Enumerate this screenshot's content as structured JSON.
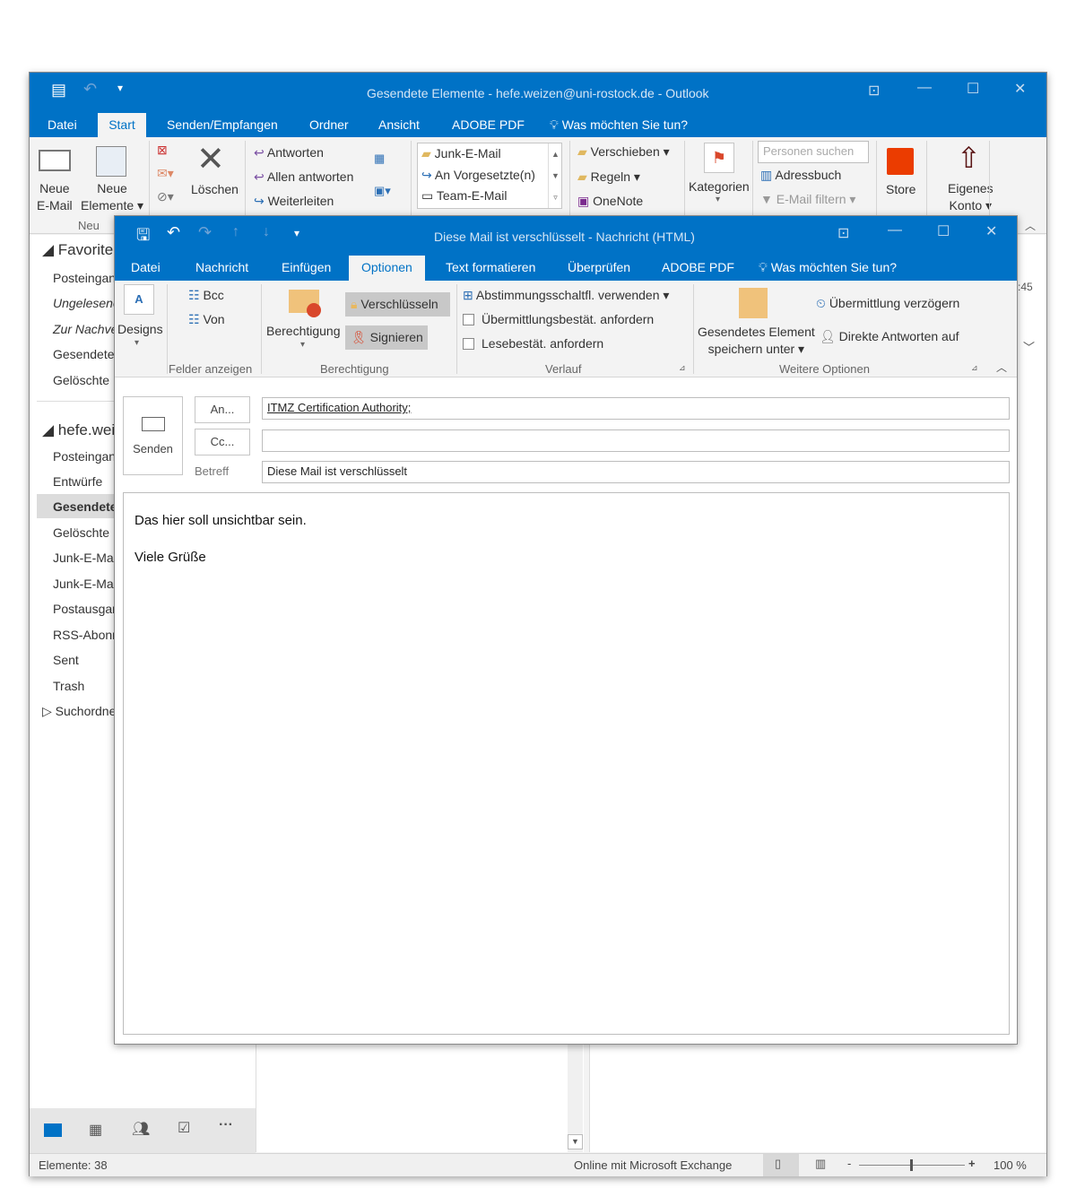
{
  "main_window": {
    "title": "Gesendete Elemente - hefe.weizen@uni-rostock.de - Outlook",
    "tabs": [
      "Datei",
      "Start",
      "Senden/Empfangen",
      "Ordner",
      "Ansicht",
      "ADOBE PDF"
    ],
    "tell_me": "Was möchten Sie tun?",
    "ribbon": {
      "new_email": [
        "Neue",
        "E-Mail"
      ],
      "new_items": [
        "Neue",
        "Elemente"
      ],
      "group_new": "Neu",
      "delete": "Löschen",
      "reply": "Antworten",
      "reply_all": "Allen antworten",
      "forward": "Weiterleiten",
      "quick_steps": [
        "Junk-E-Mail",
        "An Vorgesetzte(n)",
        "Team-E-Mail"
      ],
      "move": "Verschieben",
      "rules": "Regeln",
      "onenote": "OneNote",
      "categories": "Kategorien",
      "search_people_placeholder": "Personen suchen",
      "address_book": "Adressbuch",
      "filter_email": "E-Mail filtern",
      "store": "Store",
      "account": [
        "Eigenes",
        "Konto"
      ]
    },
    "nav": {
      "favorites_header": "Favoriten",
      "favorites": [
        "Posteingang",
        "Ungelesene",
        "Zur Nachverfolgung",
        "Gesendete",
        "Gelöschte"
      ],
      "account_header": "hefe.weizen",
      "folders": [
        "Posteingang",
        "Entwürfe",
        "Gesendete",
        "Gelöschte",
        "Junk-E-Mail",
        "Junk-E-Mail",
        "Postausgang",
        "RSS-Abonnements",
        "Sent",
        "Trash",
        "Suchordner"
      ],
      "selected_folder": "Gesendete"
    },
    "time_fragment": ":45",
    "status": {
      "items": "Elemente: 38",
      "connection": "Online mit Microsoft Exchange",
      "zoom": "100 %",
      "zoom_level": 100
    }
  },
  "compose_window": {
    "title": "Diese Mail ist verschlüsselt - Nachricht (HTML)",
    "tabs": [
      "Datei",
      "Nachricht",
      "Einfügen",
      "Optionen",
      "Text formatieren",
      "Überprüfen",
      "ADOBE PDF"
    ],
    "active_tab": "Optionen",
    "tell_me": "Was möchten Sie tun?",
    "ribbon": {
      "designs": "Designs",
      "bcc": "Bcc",
      "from": "Von",
      "group_fields": "Felder anzeigen",
      "permission": "Berechtigung",
      "encrypt": "Verschlüsseln",
      "sign": "Signieren",
      "group_permission": "Berechtigung",
      "voting": "Abstimmungsschaltfl. verwenden",
      "delivery_receipt": "Übermittlungsbestät. anfordern",
      "read_receipt": "Lesebestät. anfordern",
      "group_tracking": "Verlauf",
      "save_sent": [
        "Gesendetes Element",
        "speichern unter"
      ],
      "delay_delivery": "Übermittlung verzögern",
      "direct_replies": "Direkte Antworten auf",
      "group_more": "Weitere Optionen"
    },
    "form": {
      "send": "Senden",
      "to_button": "An...",
      "cc_button": "Cc...",
      "subject_label": "Betreff",
      "to_value": "ITMZ Certification Authority;",
      "cc_value": "",
      "subject_value": "Diese Mail ist verschlüsselt"
    },
    "body": [
      "Das hier soll unsichtbar sein.",
      "Viele Grüße"
    ]
  }
}
